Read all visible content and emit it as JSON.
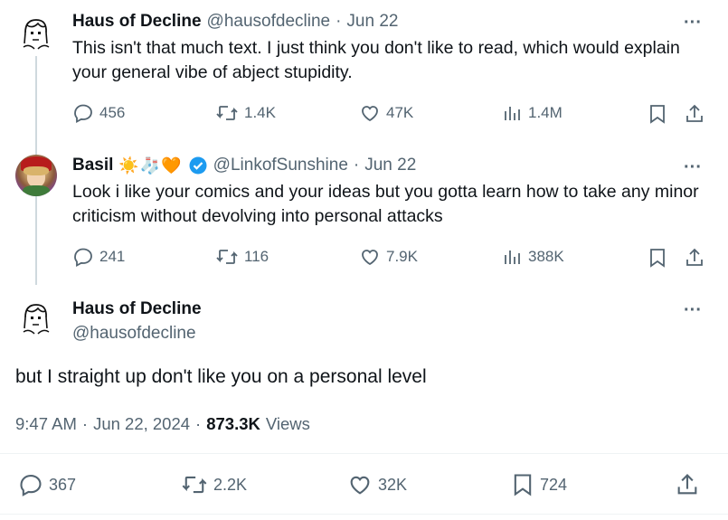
{
  "tweets": [
    {
      "name": "Haus of Decline",
      "handle": "@hausofdecline",
      "date": "Jun 22",
      "text": "This isn't that much text. I just think you don't like to read, which would explain your general vibe of abject stupidity.",
      "replies": "456",
      "retweets": "1.4K",
      "likes": "47K",
      "views": "1.4M"
    },
    {
      "name": "Basil",
      "name_emojis": "☀️🧦🧡",
      "handle": "@LinkofSunshine",
      "date": "Jun 22",
      "text": "Look i like your comics and your ideas but you gotta learn how to take any minor criticism without devolving into personal attacks",
      "replies": "241",
      "retweets": "116",
      "likes": "7.9K",
      "views": "388K"
    }
  ],
  "main": {
    "name": "Haus of Decline",
    "handle": "@hausofdecline",
    "text": "but I straight up don't like you on a personal level",
    "time": "9:47 AM",
    "date": "Jun 22, 2024",
    "views_count": "873.3K",
    "views_label": "Views",
    "replies": "367",
    "retweets": "2.2K",
    "likes": "32K",
    "bookmarks": "724"
  },
  "more_label": "···",
  "separator": "·"
}
